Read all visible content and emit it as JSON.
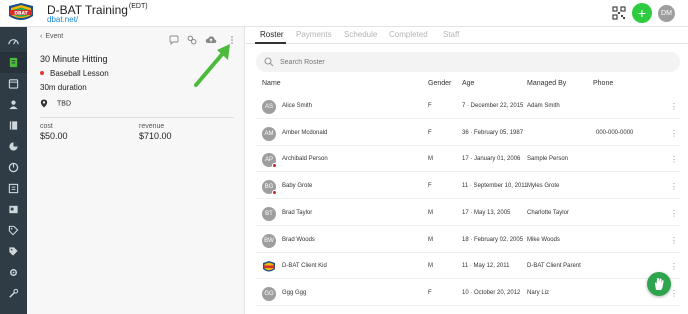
{
  "header": {
    "title": "D-BAT Training",
    "timezone": "(EDT)",
    "url": "dbat.net/",
    "avatar_initials": "DM",
    "add_symbol": "+"
  },
  "leftnav": {
    "icons": [
      "dashboard-icon",
      "schedule-icon",
      "calendar-icon",
      "people-icon",
      "book-icon",
      "reports-icon",
      "pie-chart-icon",
      "checkbook-icon",
      "card-icon",
      "tag-icon",
      "tags-icon",
      "settings-icon",
      "wrench-icon"
    ],
    "active_index": 1
  },
  "event": {
    "back_label": "Event",
    "title": "30 Minute Hitting",
    "type": "Baseball Lesson",
    "duration": "30m duration",
    "location": "TBD",
    "cost_label": "cost",
    "cost_value": "$50.00",
    "revenue_label": "revenue",
    "revenue_value": "$710.00",
    "type_color": "#e53935"
  },
  "tabs": [
    "Roster",
    "Payments",
    "Schedule",
    "Completed",
    "Staff"
  ],
  "search": {
    "placeholder": "Search Roster"
  },
  "table": {
    "headers": [
      "Name",
      "Gender",
      "Age",
      "Managed By",
      "Phone"
    ],
    "rows": [
      {
        "initials": "AS",
        "name": "Alice Smith",
        "gender": "F",
        "age": "7 · December 22, 2015",
        "managed_by": "Adam Smith",
        "phone": "",
        "badge": false
      },
      {
        "initials": "AM",
        "name": "Amber Mcdonald",
        "gender": "F",
        "age": "36 · February 05, 1987",
        "managed_by": "",
        "phone": "000-000-0000",
        "badge": false
      },
      {
        "initials": "AP",
        "name": "Archibald Person",
        "gender": "M",
        "age": "17 · January 01, 2006",
        "managed_by": "Sample Person",
        "phone": "",
        "badge": true
      },
      {
        "initials": "BG",
        "name": "Baby Grote",
        "gender": "F",
        "age": "11 · September 10, 2011",
        "managed_by": "Myles Grote",
        "phone": "",
        "badge": true
      },
      {
        "initials": "BT",
        "name": "Brad Taylor",
        "gender": "M",
        "age": "17 · May 13, 2005",
        "managed_by": "Charlotte Taylor",
        "phone": "",
        "badge": false
      },
      {
        "initials": "BW",
        "name": "Brad Woods",
        "gender": "M",
        "age": "18 · February 02, 2005",
        "managed_by": "Mike Woods",
        "phone": "",
        "badge": false
      },
      {
        "initials": "",
        "name": "D-BAT Client Kid",
        "gender": "M",
        "age": "11 · May 12, 2011",
        "managed_by": "D-BAT Client Parent",
        "phone": "",
        "badge": false,
        "logo": true
      },
      {
        "initials": "GG",
        "name": "Ggg Ggg",
        "gender": "F",
        "age": "10 · October 20, 2012",
        "managed_by": "Nary Liz",
        "phone": "",
        "badge": false
      }
    ]
  },
  "colors": {
    "nav_bg": "#2f3b45",
    "accent_green": "#2ecc40",
    "link_blue": "#1e88d8",
    "annotation_arrow": "#4cbb3c"
  }
}
